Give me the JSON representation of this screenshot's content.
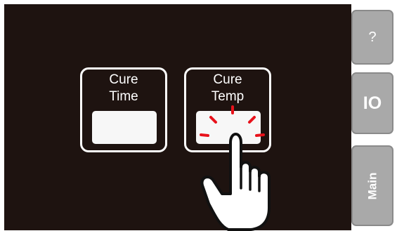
{
  "sidebar": {
    "help_label": "?",
    "io_label": "IO",
    "main_label": "Main"
  },
  "buttons": {
    "cure_time": {
      "line1": "Cure",
      "line2": "Time"
    },
    "cure_temp": {
      "line1": "Cure",
      "line2": "Temp"
    }
  },
  "colors": {
    "screen_background": "#1e1310",
    "side_button": "#a9a9a9",
    "tap_indicator": "#e8121b"
  },
  "icons": {
    "pointer": "hand-pointer-icon",
    "tap": "tap-burst-icon"
  }
}
